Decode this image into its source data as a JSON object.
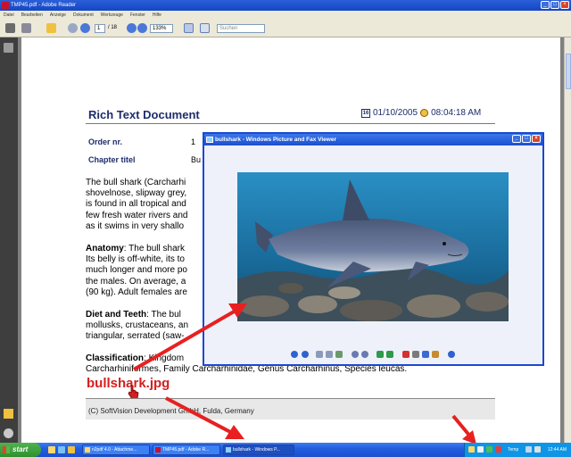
{
  "reader": {
    "title": "TMP45.pdf - Adobe Reader",
    "menu": [
      "Datei",
      "Bearbeiten",
      "Anzeige",
      "Dokument",
      "Werkzeuge",
      "Fenster",
      "Hilfe"
    ],
    "page_current": "1",
    "page_total": "/ 18",
    "zoom": "133%",
    "search_placeholder": "Suchen"
  },
  "document": {
    "title": "Rich Text Document",
    "date": "01/10/2005",
    "time": "08:04:18 AM",
    "calendar_icon_text": "16",
    "order_label": "Order nr.",
    "order_value": "1",
    "chapter_label": "Chapter titel",
    "chapter_value": "Bu",
    "intro_lines": [
      "The bull shark (Carcharhi",
      "shovelnose, slipway grey,",
      "is found in all tropical and",
      "few fresh water rivers and",
      "as it swims in very shallo"
    ],
    "anatomy_heading": "Anatomy",
    "anatomy_lines": [
      ": The bull shark",
      "Its belly is off-white, its to",
      "much longer and more po",
      "the males. On average, a",
      "(90 kg). Adult females are"
    ],
    "diet_heading": "Diet and Teeth",
    "diet_lines": [
      ": The bul",
      "mollusks, crustaceans, an",
      "triangular, serrated (saw-"
    ],
    "class_heading": "Classification",
    "class_line1": ": Kingdom",
    "class_line2": "Carcharhiniformes, Family Carcharhinidae, Genus Carcharhinus, Species leucas.",
    "file_label": "bullshark.jpg",
    "footer": "(C) SoftVision Development GmbH, Fulda, Germany"
  },
  "viewer": {
    "title": "bullshark - Windows Picture and Fax Viewer"
  },
  "taskbar": {
    "start": "start",
    "tasks": [
      "n2pdf 4.0 - Attachme...",
      "TMP45.pdf - Adobe R...",
      "bullshark - Windows P..."
    ],
    "tray_lang": "Temp",
    "clock": "12:44 AM"
  },
  "colors": {
    "doc_heading": "#1e2d6b",
    "annotation_red": "#d42020",
    "xp_blue": "#245ee0"
  }
}
